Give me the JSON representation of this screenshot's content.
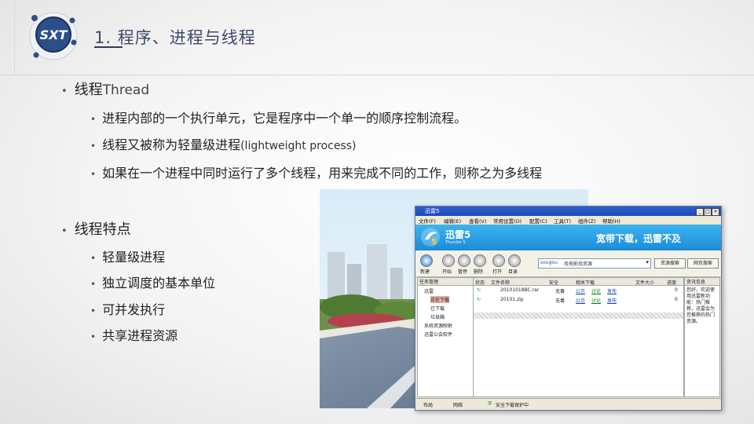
{
  "logo": {
    "text": "SXT"
  },
  "title": "1. 程序、进程与线程",
  "sections": [
    {
      "heading_main": "线程",
      "heading_en": "Thread",
      "items": [
        "进程内部的一个执行单元，它是程序中一个单一的顺序控制流程。",
        "线程又被称为轻量级进程",
        "如果在一个进程中同时运行了多个线程，用来完成不同的工作，则称之为多线程"
      ],
      "item2_suffix": "(lightweight process)"
    },
    {
      "heading_main": "线程特点",
      "items": [
        "轻量级进程",
        "独立调度的基本单位",
        "可并发执行",
        "共享进程资源"
      ]
    }
  ],
  "screenshot": {
    "window_title": "迅雷5",
    "menu": [
      "文件(F)",
      "编辑(E)",
      "查看(V)",
      "常用设置(O)",
      "配置(C)",
      "工具(T)",
      "组件(Z)",
      "帮助(H)"
    ],
    "banner_brand": "迅雷5",
    "banner_brand_sub": "Thunder 5",
    "banner_slogan": "宽带下载，迅雷不及",
    "toolbar": [
      "新建",
      "开始",
      "暂停",
      "删除",
      "打开",
      "目录"
    ],
    "search_engine": "sougou",
    "search_text": "找电影找资源",
    "search_btn1": "资源搜索",
    "search_btn2": "网页搜索",
    "left_header": "任务管理",
    "left_items": [
      "迅雷",
      "正在下载",
      "已下载",
      "垃圾箱",
      "系统资源映射",
      "迅雷公会软件"
    ],
    "columns": [
      "状态",
      "文件名称",
      "安全",
      "相关下载",
      "文件大小",
      "进度"
    ],
    "rows": [
      {
        "name": "20101018BC.rar",
        "security": "无毒",
        "links": [
          "公示",
          "讨论",
          "发布"
        ],
        "progress": "0"
      },
      {
        "name": "20101.zip",
        "security": "无毒",
        "links": [
          "公示",
          "讨论",
          "发布"
        ],
        "progress": "0"
      }
    ],
    "right_header": "资讯信息",
    "right_text": "您好，欢迎使用迅雷新功能：热门推荐，迅雷会为您推荐的热门资源。",
    "status_items": [
      "布局",
      "网络",
      "安全下载保护中"
    ]
  }
}
